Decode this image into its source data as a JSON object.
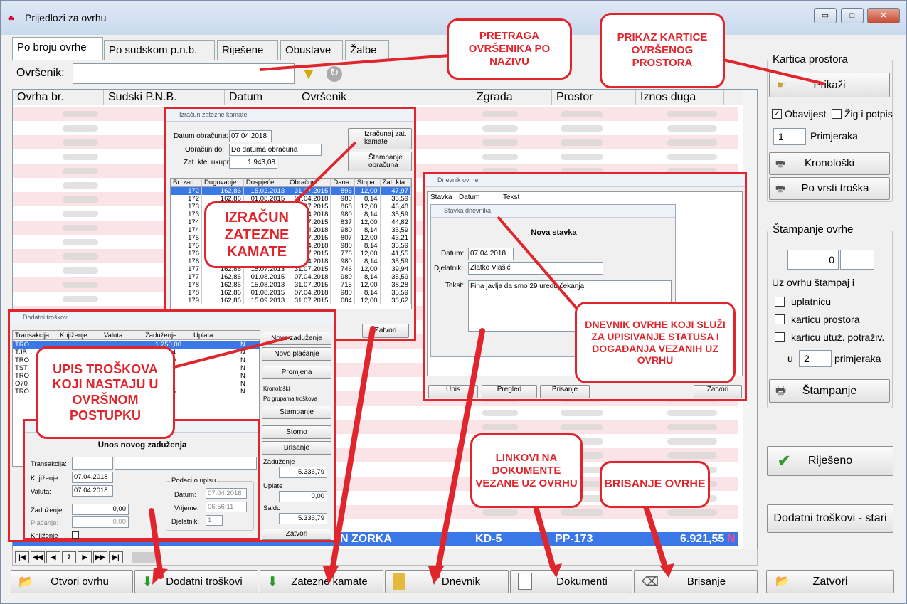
{
  "window": {
    "title": "Prijedlozi za ovrhu",
    "min": "▭",
    "max": "□",
    "close": "✕"
  },
  "tabs": [
    "Po broju ovrhe",
    "Po sudskom p.n.b.",
    "Riješene",
    "Obustave",
    "Žalbe"
  ],
  "search": {
    "label": "Ovršenik:",
    "value": ""
  },
  "grid": {
    "columns": [
      "Ovrha br.",
      "Sudski P.N.B.",
      "Datum",
      "Ovršenik",
      "Zgrada",
      "Prostor",
      "Iznos duga"
    ],
    "selected_row": {
      "ovrsenik": "N ZORKA",
      "zgrada": "KD-5",
      "prostor": "PP-173",
      "iznos": "6.921,55",
      "flag": "N"
    }
  },
  "right_panel": {
    "kartica_title": "Kartica prostora",
    "prikazi": "Prikaži",
    "obavijest": "Obavijest",
    "zig": "Žig i potpis",
    "copies": "1",
    "primjeraka": "Primjeraka",
    "kronoloski": "Kronološki",
    "po_vrsti": "Po vrsti troška",
    "stampanje_title": "Štampanje ovrhe",
    "num_value": "0",
    "uz_ovrhu": "Uz ovrhu štampaj i",
    "uplatnicu": "uplatnicu",
    "karticu_prostora": "karticu prostora",
    "karticu_utuz": "karticu utuž. potraživ.",
    "u": "u",
    "copies2": "2",
    "primjeraka2": "primjeraka",
    "stampanje": "Štampanje",
    "rijeseno": "Riješeno",
    "dodatni_stari": "Dodatni troškovi - stari",
    "zatvori": "Zatvori"
  },
  "bottom_buttons": [
    "Otvori ovrhu",
    "Dodatni troškovi",
    "Zatezne kamate",
    "Dnevnik",
    "Dokumenti",
    "Brisanje"
  ],
  "kamata": {
    "title": "Izračun zatezne kamate",
    "datum_label": "Datum obračuna:",
    "datum": "07.04.2018",
    "obracun_label": "Obračun do:",
    "obracun": "Do datuma obračuna",
    "ukupno_label": "Zat. kte. ukupno:",
    "ukupno": "1.943,08",
    "btn_izracunaj": "Izračunaj zat. kamate",
    "btn_stampanje": "Štampanje obračuna",
    "cols": [
      "Br. zad.",
      "Dugovanje",
      "Dospjeće",
      "Obračun",
      "Dana",
      "Stopa",
      "Zat. kta"
    ],
    "rows": [
      [
        "172",
        "162,86",
        "15.02.2013",
        "31.07.2015",
        "896",
        "12,00",
        "47,97"
      ],
      [
        "172",
        "162,86",
        "01.08.2015",
        "07.04.2018",
        "980",
        "8,14",
        "35,59"
      ],
      [
        "173",
        "162,86",
        "",
        "31.07.2015",
        "868",
        "12,00",
        "46,48"
      ],
      [
        "173",
        "162,86",
        "",
        "07.04.2018",
        "980",
        "8,14",
        "35,59"
      ],
      [
        "174",
        "162,86",
        "",
        "31.07.2015",
        "837",
        "12,00",
        "44,82"
      ],
      [
        "174",
        "162,86",
        "",
        "07.04.2018",
        "980",
        "8,14",
        "35,59"
      ],
      [
        "175",
        "162,86",
        "",
        "31.07.2015",
        "807",
        "12,00",
        "43,21"
      ],
      [
        "175",
        "162,86",
        "",
        "07.04.2018",
        "980",
        "8,14",
        "35,59"
      ],
      [
        "176",
        "162,86",
        "",
        "31.07.2015",
        "776",
        "12,00",
        "41,55"
      ],
      [
        "176",
        "162,86",
        "",
        "07.04.2018",
        "980",
        "8,14",
        "35,59"
      ],
      [
        "177",
        "162,86",
        "15.07.2013",
        "31.07.2015",
        "746",
        "12,00",
        "39,94"
      ],
      [
        "177",
        "162,86",
        "01.08.2015",
        "07.04.2018",
        "980",
        "8,14",
        "35,59"
      ],
      [
        "178",
        "162,86",
        "15.08.2013",
        "31.07.2015",
        "715",
        "12,00",
        "38,28"
      ],
      [
        "178",
        "162,86",
        "01.08.2015",
        "07.04.2018",
        "980",
        "8,14",
        "35,59"
      ],
      [
        "179",
        "162,86",
        "15.09.2013",
        "31.07.2015",
        "684",
        "12,00",
        "36,62"
      ]
    ],
    "zatvori": "Zatvori"
  },
  "troskovi": {
    "title": "Dodatni troškovi",
    "cols": [
      "Transakcija",
      "Knjiženje",
      "Valuta",
      "Zaduženje",
      "Uplata"
    ],
    "rows": [
      {
        "t": "TRO",
        "z": "1.250,00",
        "n": "N"
      },
      {
        "t": "TJB",
        "z": "666,04",
        "n": "N"
      },
      {
        "t": "TRO",
        "z": "250,00",
        "n": "N"
      },
      {
        "t": "TST",
        "z": "",
        "n": "N"
      },
      {
        "t": "TRO",
        "z": "",
        "n": "N"
      },
      {
        "t": "O70",
        "z": "",
        "n": "N"
      },
      {
        "t": "TRO",
        "z": "327,75",
        "n": "N"
      }
    ],
    "btn_novo_zad": "Novo zaduženje",
    "btn_novo_plac": "Novo plaćanje",
    "btn_promjena": "Promjena",
    "radio_kron": "Kronološki",
    "radio_grupe": "Po grupama troškova",
    "btn_stampanje": "Štampanje",
    "btn_storno": "Storno",
    "btn_brisanje": "Brisanje",
    "zaduzenje_label": "Zaduženje",
    "zaduzenje": "5.336,79",
    "uplate_label": "Uplate",
    "uplate": "0,00",
    "saldo_label": "Saldo",
    "saldo": "5.336,79",
    "zatvori": "Zatvori"
  },
  "unos": {
    "title": "Unos novog zaduženja",
    "transakcija": "Transakcija:",
    "knjizenje": "Knjiženje:",
    "knjizenje_val": "07.04.2018",
    "valuta": "Valuta:",
    "valuta_val": "07.04.2018",
    "zaduzenje": "Zaduženje:",
    "zaduzenje_val": "0,00",
    "placanje": "Plaćanje:",
    "placanje_val": "0,00",
    "knjizenje_chk": "Knjiženje",
    "podaci": "Podaci o upisu",
    "datum": "Datum:",
    "datum_val": "07.04.2018",
    "vrijeme": "Vrijeme:",
    "vrijeme_val": "06:56:11",
    "djelatnik": "Djelatnik:",
    "djelatnik_val": "1"
  },
  "dnevnik": {
    "title": "Dnevnik ovrhe",
    "cols": [
      "Stavka",
      "Datum",
      "Tekst"
    ],
    "btn_upis": "Upis",
    "btn_pregled": "Pregled",
    "btn_brisanje": "Brisanje",
    "btn_zatvori": "Zatvori"
  },
  "stavka": {
    "title": "Stavka dnevnika",
    "heading": "Nova stavka",
    "datum": "Datum:",
    "datum_val": "07.04.2018",
    "djelatnik": "Djelatnik:",
    "djelatnik_val": "Zlatko Vlašić",
    "tekst": "Tekst:",
    "tekst_val": "Fina javlja da smo 29 uredu čekanja"
  },
  "callouts": {
    "pretraga": "PRETRAGA OVRŠENIKA PO NAZIVU",
    "prikaz": "PRIKAZ KARTICE OVRŠENOG PROSTORA",
    "izracun": "IZRAČUN ZATEZNE KAMATE",
    "upis": "UPIS TROŠKOVA KOJI NASTAJU U OVRŠNOM POSTUPKU",
    "dnevnik": "DNEVNIK OVRHE KOJI SLUŽI ZA UPISIVANJE STATUSA I DOGAĐANJA VEZANIH UZ OVRHU",
    "linkovi": "LINKOVI NA DOKUMENTE VEZANE UZ OVRHU",
    "brisanje": "BRISANJE OVRHE"
  },
  "colors": {
    "accent_red": "#e0262c",
    "selection": "#3b78e7",
    "row_pink": "#fbe4e8"
  }
}
